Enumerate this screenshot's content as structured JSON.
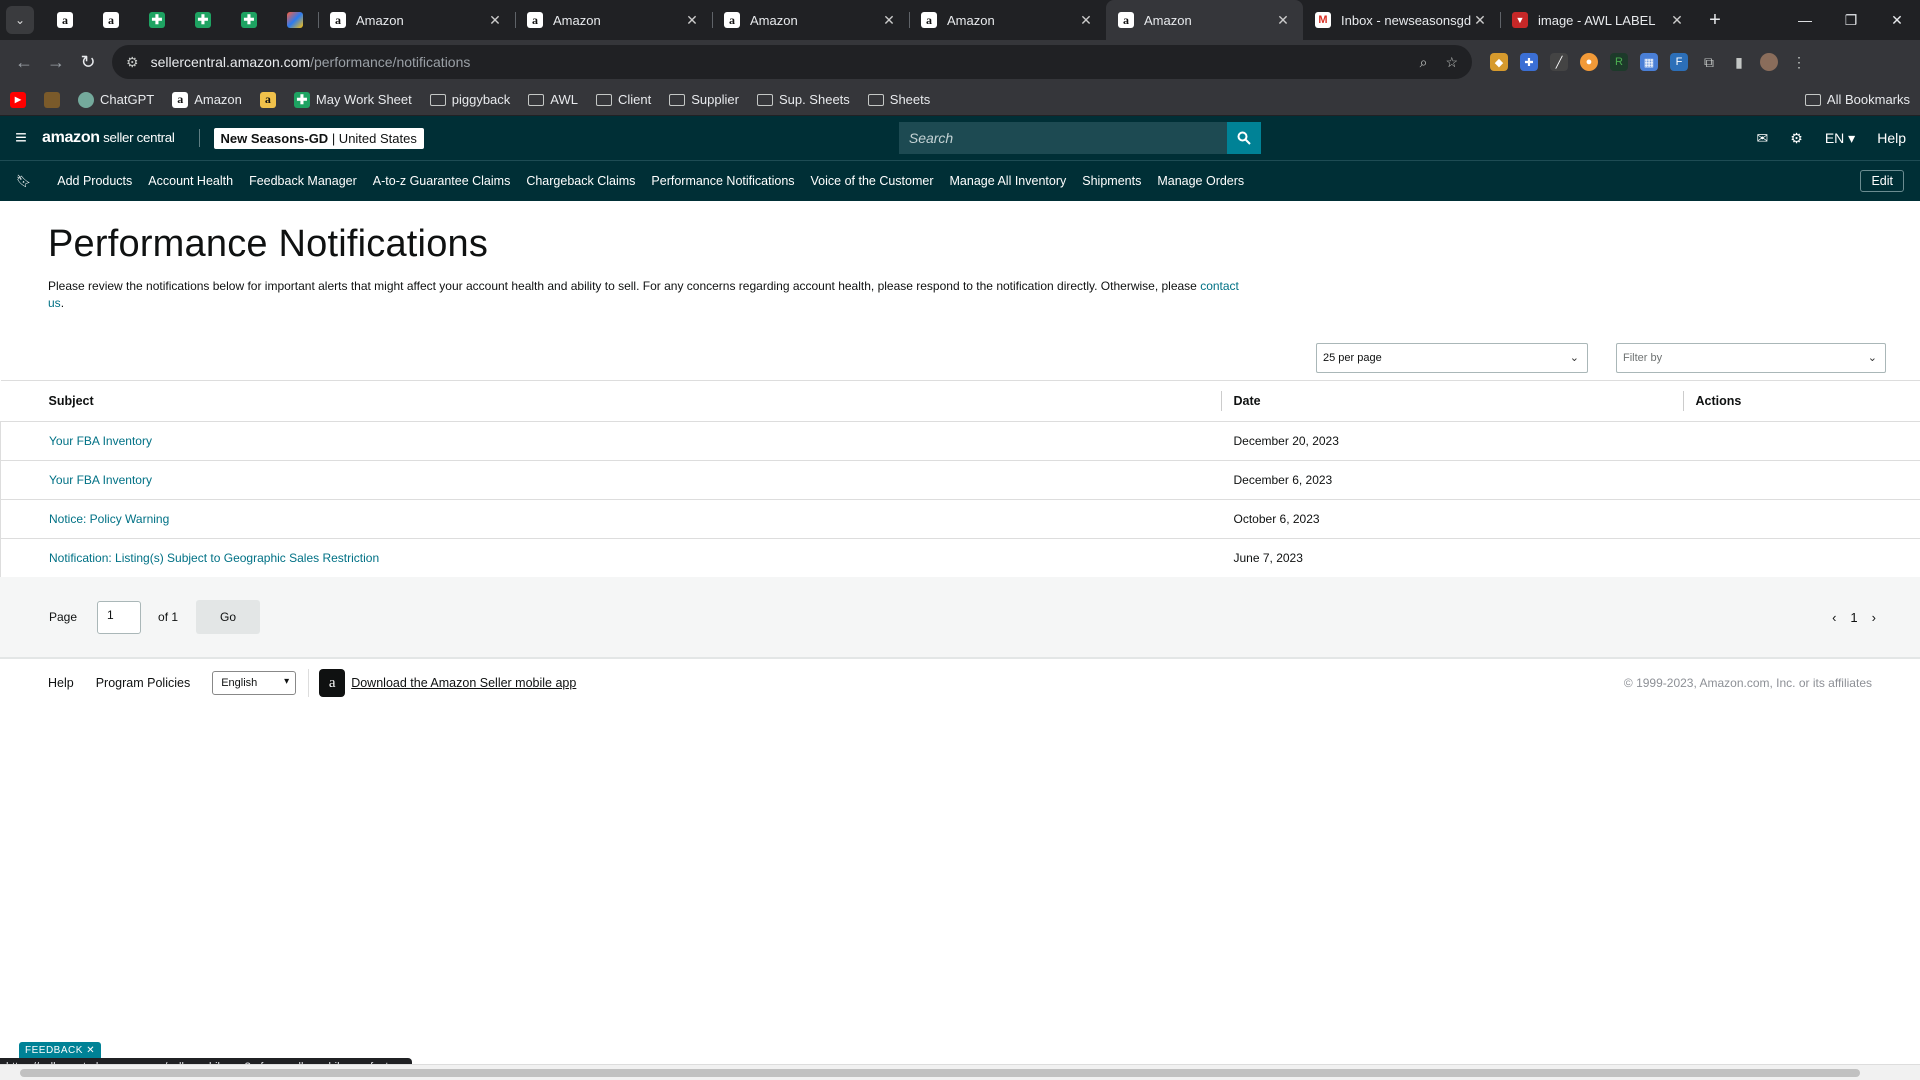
{
  "browser": {
    "pinned_tabs": [
      {
        "icon": "amazon-icon",
        "glyph": "a"
      },
      {
        "icon": "amazon-icon",
        "glyph": "a"
      },
      {
        "icon": "sheets-icon",
        "glyph": "✚"
      },
      {
        "icon": "sheets-icon",
        "glyph": "✚"
      },
      {
        "icon": "sheets-icon",
        "glyph": "✚"
      },
      {
        "icon": "multicolor-app-icon",
        "glyph": ""
      }
    ],
    "tabs": [
      {
        "title": "Amazon",
        "icon": "amazon-icon"
      },
      {
        "title": "Amazon",
        "icon": "amazon-icon"
      },
      {
        "title": "Amazon",
        "icon": "amazon-icon"
      },
      {
        "title": "Amazon",
        "icon": "amazon-icon"
      },
      {
        "title": "Amazon",
        "icon": "amazon-icon",
        "active": true
      },
      {
        "title": "Inbox - newseasonsgd@",
        "icon": "gmail-icon"
      },
      {
        "title": "image - AWL LABEL",
        "icon": "awl-icon"
      }
    ],
    "url_host": "sellercentral.amazon.com",
    "url_path": "/performance/notifications",
    "bookmarks": [
      {
        "label": "",
        "icon": "youtube-icon"
      },
      {
        "label": "",
        "icon": "cookie-icon"
      },
      {
        "label": "ChatGPT",
        "icon": "chatgpt-icon"
      },
      {
        "label": "Amazon",
        "icon": "amazon-icon"
      },
      {
        "label": "",
        "icon": "amazon-icon"
      },
      {
        "label": "May Work Sheet",
        "icon": "sheets-icon"
      },
      {
        "label": "piggyback",
        "icon": "folder-icon"
      },
      {
        "label": "AWL",
        "icon": "folder-icon"
      },
      {
        "label": "Client",
        "icon": "folder-icon"
      },
      {
        "label": "Supplier",
        "icon": "folder-icon"
      },
      {
        "label": "Sup. Sheets",
        "icon": "folder-icon"
      },
      {
        "label": "Sheets",
        "icon": "folder-icon"
      }
    ],
    "all_bookmarks": "All Bookmarks",
    "status_url": "https://sellercentral.amazon.com/sellermobileapp?ref=xx_sellermobileapp_foot_xx"
  },
  "header": {
    "logo_main": "amazon",
    "logo_sub": " seller central",
    "store_name": "New Seasons-GD",
    "store_region": " | United States",
    "search_placeholder": "Search",
    "lang": "EN ▾",
    "help": "Help"
  },
  "nav": {
    "links": [
      "Add Products",
      "Account Health",
      "Feedback Manager",
      "A-to-z Guarantee Claims",
      "Chargeback Claims",
      "Performance Notifications",
      "Voice of the Customer",
      "Manage All Inventory",
      "Shipments",
      "Manage Orders"
    ],
    "edit": "Edit"
  },
  "main": {
    "title": "Performance Notifications",
    "description": "Please review the notifications below for important alerts that might affect your account health and ability to sell. For any concerns regarding account health, please respond to the notification directly. Otherwise, please ",
    "contact_link": "contact us",
    "per_page": "25 per page",
    "filter_placeholder": "Filter by",
    "columns": {
      "subject": "Subject",
      "date": "Date",
      "actions": "Actions"
    },
    "rows": [
      {
        "subject": "Your FBA Inventory",
        "date": "December 20, 2023"
      },
      {
        "subject": "Your FBA Inventory",
        "date": "December 6, 2023"
      },
      {
        "subject": "Notice: Policy Warning",
        "date": "October 6, 2023"
      },
      {
        "subject": "Notification: Listing(s) Subject to Geographic Sales Restriction",
        "date": "June 7, 2023"
      }
    ],
    "pager": {
      "page_label": "Page",
      "page_value": "1",
      "of_label": "of 1",
      "go": "Go",
      "current": "1"
    }
  },
  "footer": {
    "help": "Help",
    "policies": "Program Policies",
    "language": "English",
    "app_link": "Download the Amazon Seller mobile app",
    "copyright": "© 1999-2023, Amazon.com, Inc. or its affiliates",
    "feedback": "FEEDBACK"
  }
}
